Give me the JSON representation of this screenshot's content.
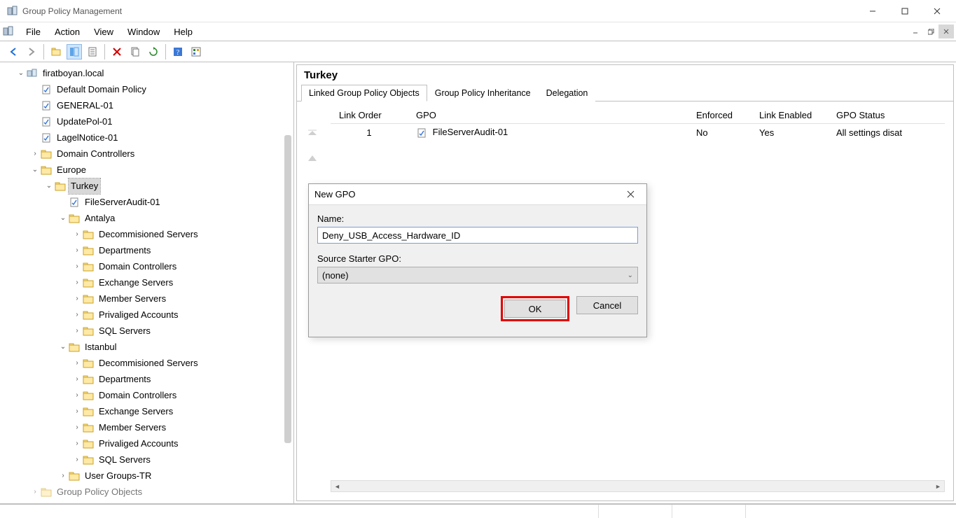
{
  "window": {
    "title": "Group Policy Management"
  },
  "menu": {
    "file": "File",
    "action": "Action",
    "view": "View",
    "window": "Window",
    "help": "Help"
  },
  "tree": {
    "domain": "firatboyan.local",
    "ddp": "Default Domain Policy",
    "general01": "GENERAL-01",
    "updatepol01": "UpdatePol-01",
    "lagelnotice01": "LagelNotice-01",
    "dc": "Domain Controllers",
    "europe": "Europe",
    "turkey": "Turkey",
    "fsa": "FileServerAudit-01",
    "antalya": "Antalya",
    "istanbul": "Istanbul",
    "sub": {
      "decom": "Decommisioned Servers",
      "dept": "Departments",
      "dc": "Domain Controllers",
      "exch": "Exchange Servers",
      "member": "Member Servers",
      "priv": "Privaliged Accounts",
      "sql": "SQL Servers"
    },
    "usergroups": "User Groups-TR",
    "gpoobjects": "Group Policy Objects"
  },
  "right": {
    "heading": "Turkey",
    "tabs": {
      "linked": "Linked Group Policy Objects",
      "inheritance": "Group Policy Inheritance",
      "delegation": "Delegation"
    },
    "columns": {
      "linkorder": "Link Order",
      "gpo": "GPO",
      "enforced": "Enforced",
      "linkenabled": "Link Enabled",
      "gpostatus": "GPO Status"
    },
    "row1": {
      "order": "1",
      "gpo": "FileServerAudit-01",
      "enforced": "No",
      "linkenabled": "Yes",
      "status": "All settings disat"
    }
  },
  "dialog": {
    "title": "New GPO",
    "name_label": "Name:",
    "name_value": "Deny_USB_Access_Hardware_ID",
    "starter_label": "Source Starter GPO:",
    "starter_value": "(none)",
    "ok": "OK",
    "cancel": "Cancel"
  }
}
